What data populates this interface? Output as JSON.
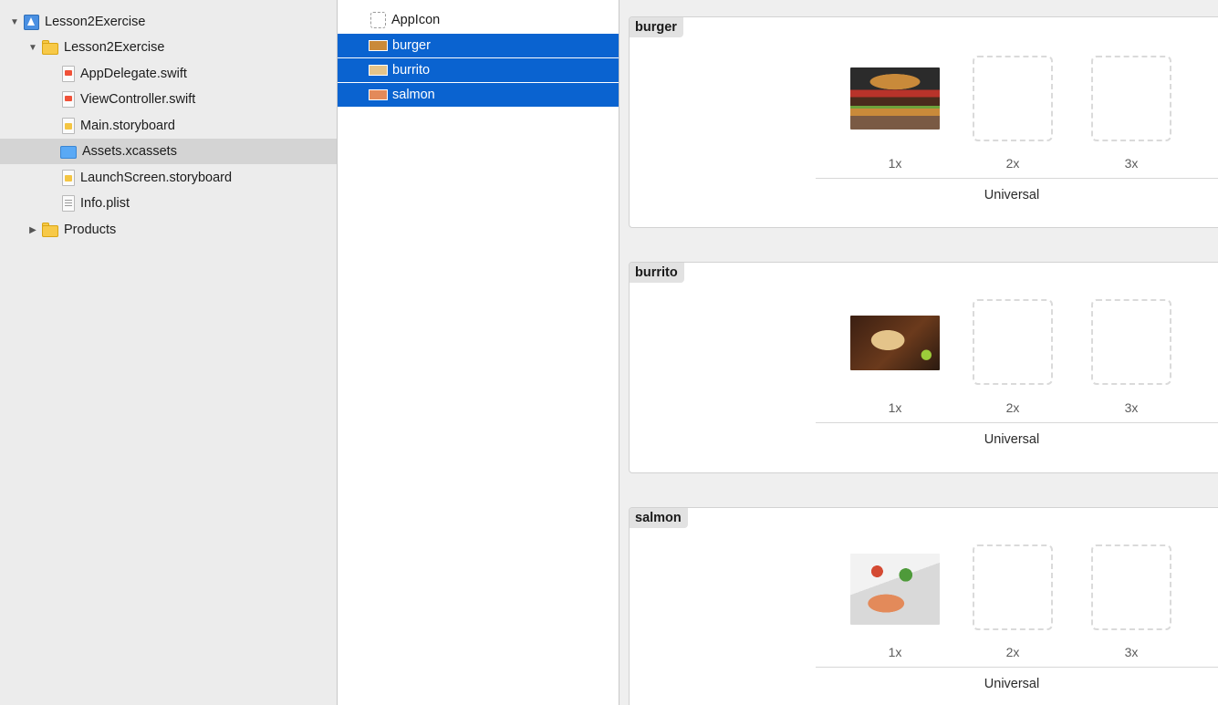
{
  "navigator": {
    "items": [
      {
        "label": "Lesson2Exercise",
        "icon": "project-icon",
        "disclosure": "▼"
      },
      {
        "label": "Lesson2Exercise",
        "icon": "folder-icon",
        "disclosure": "▼"
      },
      {
        "label": "AppDelegate.swift",
        "icon": "swift-file-icon"
      },
      {
        "label": "ViewController.swift",
        "icon": "swift-file-icon"
      },
      {
        "label": "Main.storyboard",
        "icon": "storyboard-file-icon"
      },
      {
        "label": "Assets.xcassets",
        "icon": "asset-catalog-icon",
        "selected": true
      },
      {
        "label": "LaunchScreen.storyboard",
        "icon": "storyboard-file-icon"
      },
      {
        "label": "Info.plist",
        "icon": "plist-file-icon"
      },
      {
        "label": "Products",
        "icon": "folder-icon",
        "disclosure": "▶"
      }
    ]
  },
  "asset_list": {
    "items": [
      {
        "label": "AppIcon",
        "selected": false
      },
      {
        "label": "burger",
        "selected": true
      },
      {
        "label": "burrito",
        "selected": true
      },
      {
        "label": "salmon",
        "selected": true
      }
    ]
  },
  "detail": {
    "image_sets": [
      {
        "title": "burger",
        "scales": [
          "1x",
          "2x",
          "3x"
        ],
        "device": "Universal"
      },
      {
        "title": "burrito",
        "scales": [
          "1x",
          "2x",
          "3x"
        ],
        "device": "Universal"
      },
      {
        "title": "salmon",
        "scales": [
          "1x",
          "2x",
          "3x"
        ],
        "device": "Universal"
      }
    ]
  },
  "colors": {
    "selection_blue": "#0a63d0",
    "navigator_background": "#ececec",
    "detail_background": "#efefef"
  }
}
